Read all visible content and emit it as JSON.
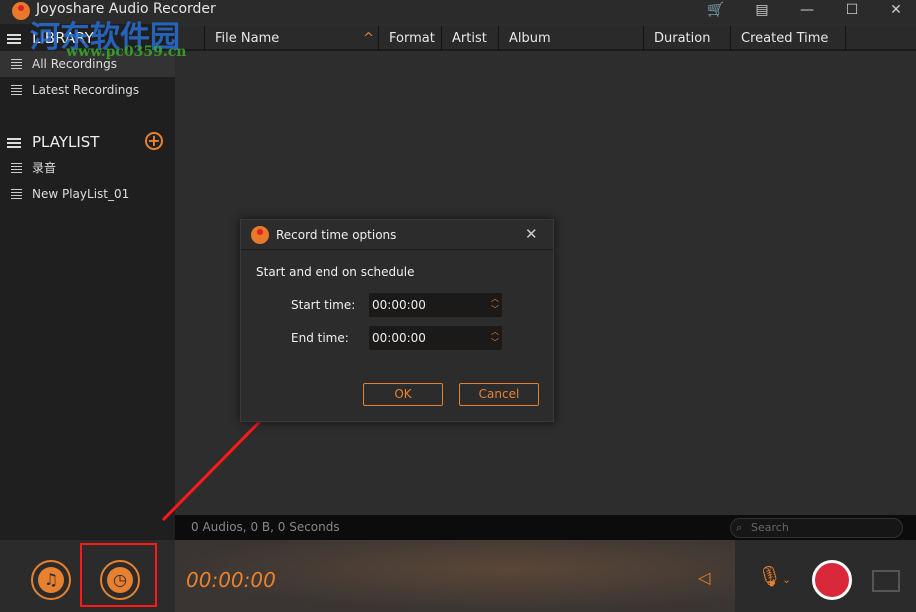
{
  "app": {
    "title": "Joyoshare Audio Recorder"
  },
  "watermark": {
    "line1": "河东软件园",
    "line2": "www.pc0359.cn"
  },
  "sidebar": {
    "library": "LIBRARY",
    "library_items": [
      {
        "label": "All Recordings"
      },
      {
        "label": "Latest Recordings"
      }
    ],
    "playlist": "PLAYLIST",
    "playlist_items": [
      {
        "label": "录音"
      },
      {
        "label": "New PlayList_01"
      }
    ]
  },
  "table": {
    "columns": [
      "File Name",
      "Format",
      "Artist",
      "Album",
      "Duration",
      "Created Time"
    ]
  },
  "status": {
    "text": "0 Audios, 0 B, 0 Seconds",
    "search_placeholder": "Search"
  },
  "player": {
    "time": "00:00:00"
  },
  "dialog": {
    "title": "Record time options",
    "heading": "Start and end on schedule",
    "start_label": "Start time:",
    "start_value": "00:00:00",
    "end_label": "End time:",
    "end_value": "00:00:00",
    "ok": "OK",
    "cancel": "Cancel"
  },
  "colors": {
    "accent": "#e8812f",
    "record": "#d8283a",
    "highlight": "#ff1a1a"
  }
}
